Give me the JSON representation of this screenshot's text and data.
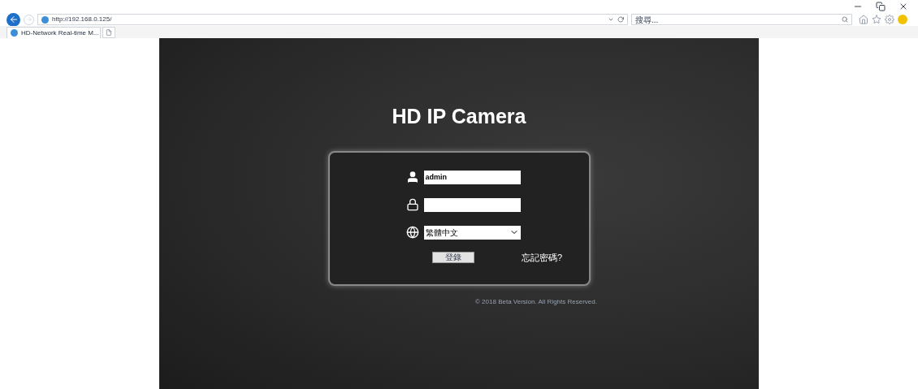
{
  "browser": {
    "address": "http://192.168.0.125/",
    "search_placeholder": "搜尋...",
    "tabs": [
      {
        "title": "HD-Network Real-time M...",
        "selected": true
      }
    ]
  },
  "login": {
    "title": "HD IP Camera",
    "username": "admin",
    "language": "繁體中文",
    "login_button": "登錄",
    "forgot_link": "忘記密碼?",
    "copyright": "© 2018 Beta Version. All Rights Reserved."
  }
}
